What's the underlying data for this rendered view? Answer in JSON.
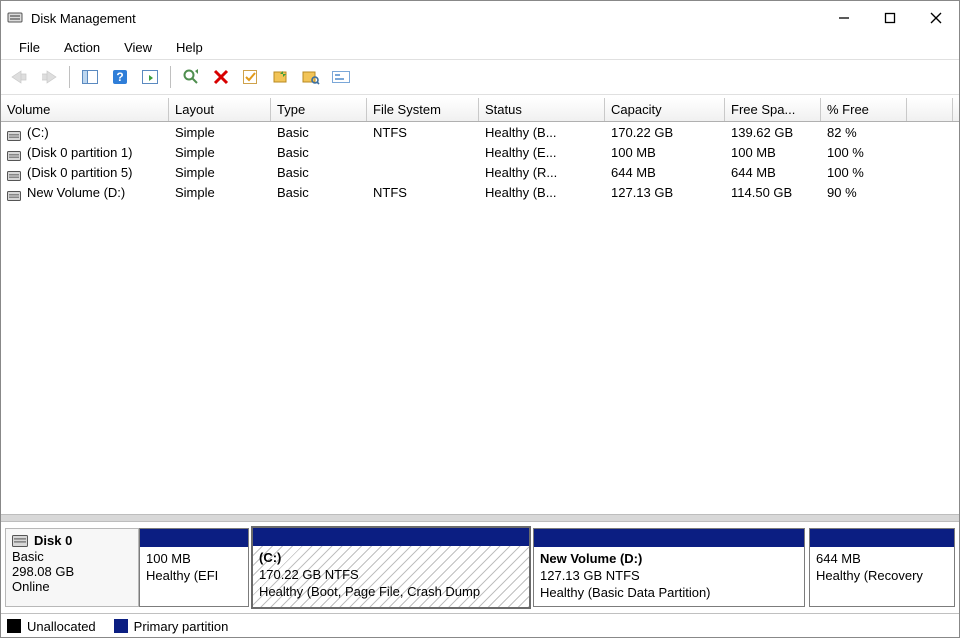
{
  "app": {
    "title": "Disk Management"
  },
  "menus": {
    "file": "File",
    "action": "Action",
    "view": "View",
    "help": "Help"
  },
  "columns": {
    "volume": "Volume",
    "layout": "Layout",
    "type": "Type",
    "filesystem": "File System",
    "status": "Status",
    "capacity": "Capacity",
    "freespace": "Free Spa...",
    "pctfree": "% Free"
  },
  "volumes": [
    {
      "name": "(C:)",
      "layout": "Simple",
      "type": "Basic",
      "fs": "NTFS",
      "status": "Healthy (B...",
      "capacity": "170.22 GB",
      "free": "139.62 GB",
      "pct": "82 %"
    },
    {
      "name": "(Disk 0 partition 1)",
      "layout": "Simple",
      "type": "Basic",
      "fs": "",
      "status": "Healthy (E...",
      "capacity": "100 MB",
      "free": "100 MB",
      "pct": "100 %"
    },
    {
      "name": "(Disk 0 partition 5)",
      "layout": "Simple",
      "type": "Basic",
      "fs": "",
      "status": "Healthy (R...",
      "capacity": "644 MB",
      "free": "644 MB",
      "pct": "100 %"
    },
    {
      "name": "New Volume (D:)",
      "layout": "Simple",
      "type": "Basic",
      "fs": "NTFS",
      "status": "Healthy (B...",
      "capacity": "127.13 GB",
      "free": "114.50 GB",
      "pct": "90 %"
    }
  ],
  "disk0": {
    "header": "Disk 0",
    "type": "Basic",
    "size": "298.08 GB",
    "state": "Online",
    "parts": [
      {
        "title": "",
        "line1": "100 MB",
        "line2": "Healthy (EFI"
      },
      {
        "title": "(C:)",
        "line1": "170.22 GB NTFS",
        "line2": "Healthy (Boot, Page File, Crash Dump"
      },
      {
        "title": "New Volume  (D:)",
        "line1": "127.13 GB NTFS",
        "line2": "Healthy (Basic Data Partition)"
      },
      {
        "title": "",
        "line1": "644 MB",
        "line2": "Healthy (Recovery"
      }
    ]
  },
  "legend": {
    "unallocated": "Unallocated",
    "primary": "Primary partition"
  }
}
